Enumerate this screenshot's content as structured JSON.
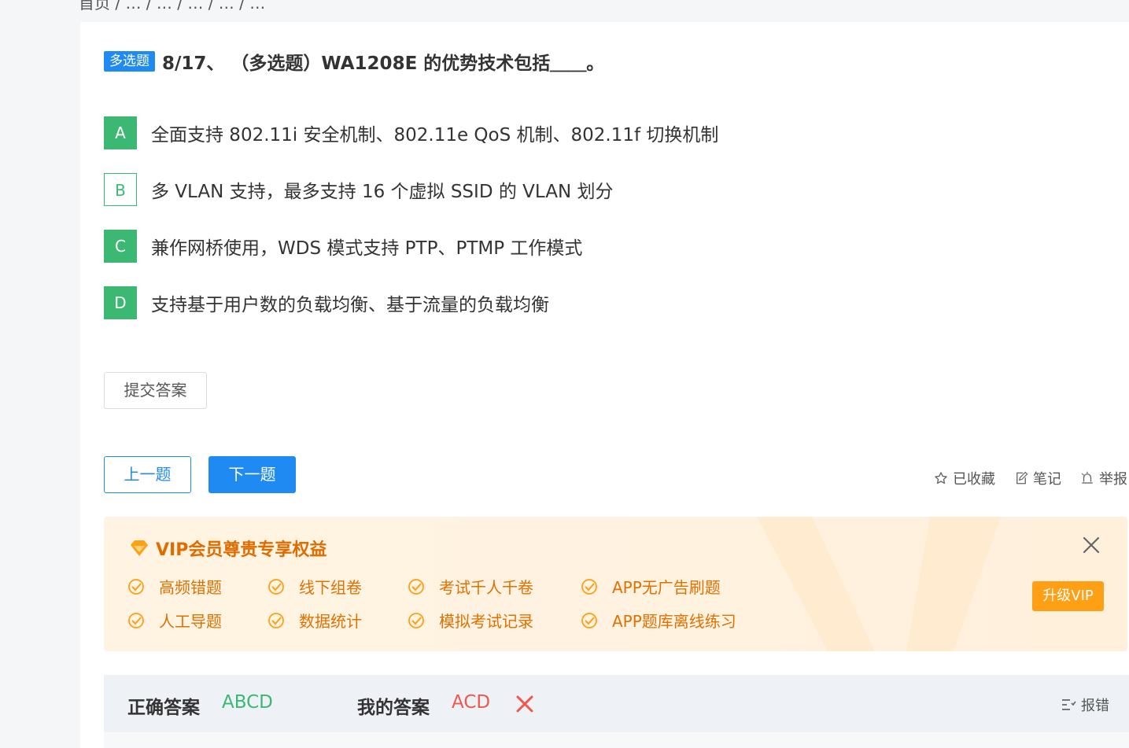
{
  "breadcrumb": "首页  /  …  /  …  /  …  /  …  /  …",
  "question": {
    "type_tag": "多选题",
    "title": "8/17、 （多选题）WA1208E 的优势技术包括＿＿。"
  },
  "options": [
    {
      "letter": "A",
      "text": "全面支持 802.11i 安全机制、802.11e QoS 机制、802.11f 切换机制",
      "selected": true
    },
    {
      "letter": "B",
      "text": "多 VLAN 支持，最多支持 16 个虚拟 SSID 的 VLAN 划分",
      "selected": false
    },
    {
      "letter": "C",
      "text": "兼作网桥使用，WDS 模式支持 PTP、PTMP 工作模式",
      "selected": true
    },
    {
      "letter": "D",
      "text": "支持基于用户数的负载均衡、基于流量的负载均衡",
      "selected": true
    }
  ],
  "buttons": {
    "submit": "提交答案",
    "prev": "上一题",
    "next": "下一题"
  },
  "tools": {
    "favorite": "已收藏",
    "note": "笔记",
    "report": "举报"
  },
  "vip": {
    "title": "VIP会员尊贵专享权益",
    "perks": [
      "高频错题",
      "线下组卷",
      "考试千人千卷",
      "APP无广告刷题",
      "人工导题",
      "数据统计",
      "模拟考试记录",
      "APP题库离线练习"
    ],
    "upgrade": "升级VIP"
  },
  "answer": {
    "correct_label": "正确答案",
    "correct_value": "ABCD",
    "mine_label": "我的答案",
    "mine_value": "ACD",
    "report": "报错"
  },
  "colors": {
    "blue": "#1f8bf2",
    "green": "#3db873",
    "orange": "#e07100",
    "red": "#f0584e"
  },
  "icons": [
    "star-icon",
    "edit-icon",
    "bell-icon",
    "diamond-icon",
    "close-icon",
    "check-circle-icon",
    "wrong-icon",
    "report-icon"
  ]
}
